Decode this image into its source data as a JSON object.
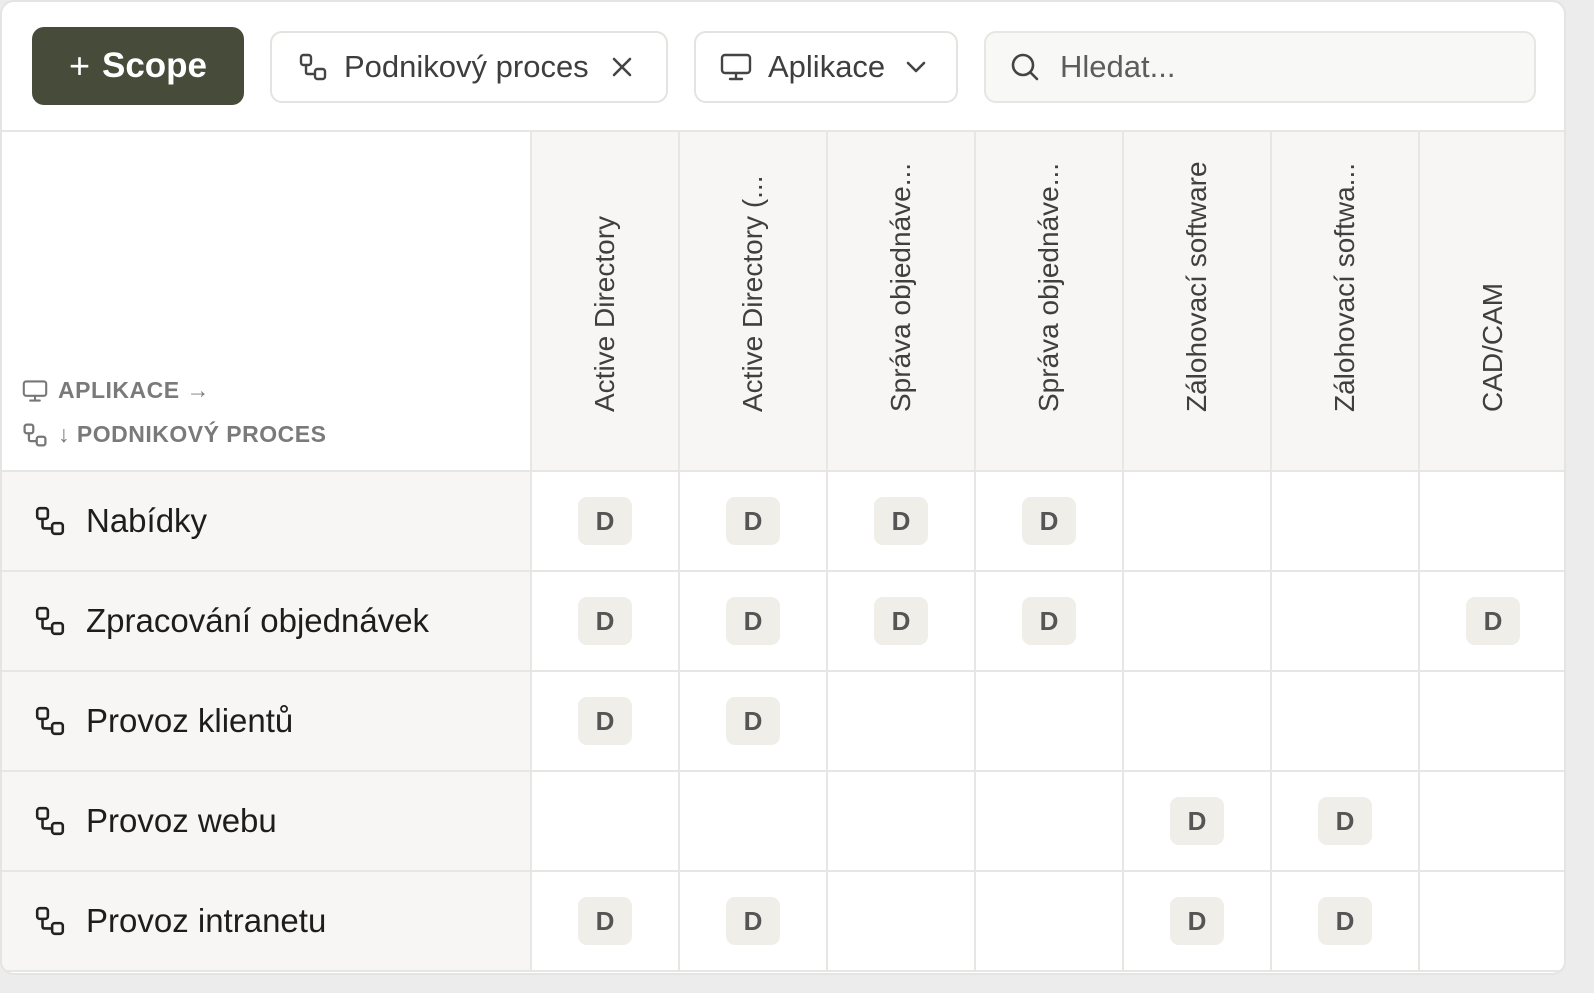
{
  "toolbar": {
    "scope_label": "Scope",
    "process_filter": "Podnikový proces",
    "app_filter": "Aplikace",
    "search_placeholder": "Hledat..."
  },
  "corner": {
    "columns_axis": "APLIKACE →",
    "rows_axis": "↓ PODNIKOVÝ PROCES"
  },
  "columns": [
    "Active Directory",
    "Active Directory (...",
    "Správa objednáve...",
    "Správa objednáve...",
    "Zálohovací software",
    "Zálohovací softwa...",
    "CAD/CAM"
  ],
  "rows": [
    {
      "label": "Nabídky",
      "cells": [
        "D",
        "D",
        "D",
        "D",
        "",
        "",
        ""
      ]
    },
    {
      "label": "Zpracování objednávek",
      "cells": [
        "D",
        "D",
        "D",
        "D",
        "",
        "",
        "D"
      ]
    },
    {
      "label": "Provoz klientů",
      "cells": [
        "D",
        "D",
        "",
        "",
        "",
        "",
        ""
      ]
    },
    {
      "label": "Provoz webu",
      "cells": [
        "",
        "",
        "",
        "",
        "D",
        "D",
        ""
      ]
    },
    {
      "label": "Provoz intranetu",
      "cells": [
        "D",
        "D",
        "",
        "",
        "D",
        "D",
        ""
      ]
    }
  ],
  "colors": {
    "primary_button": "#474b3a",
    "header_bg": "#f7f6f4",
    "badge_bg": "#efeee9"
  }
}
